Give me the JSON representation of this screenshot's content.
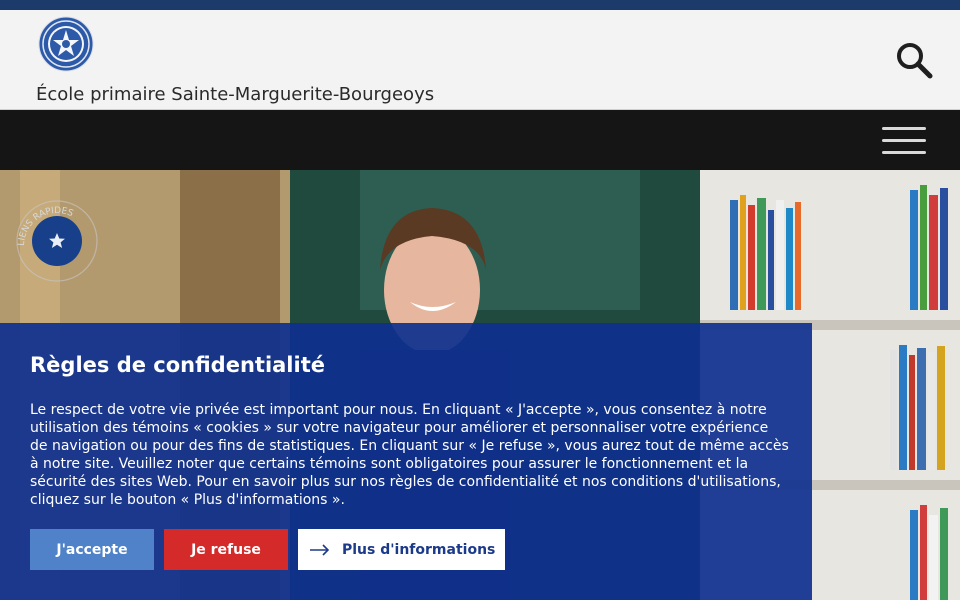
{
  "header": {
    "school_name": "École primaire Sainte-Marguerite-Bourgeoys",
    "logo_icon": "school-crest-icon",
    "search_icon": "search-icon"
  },
  "nav": {
    "menu_icon": "hamburger-menu-icon"
  },
  "hero": {
    "quick_links_label": "LIENS RAPIDES",
    "quick_links_icon": "star-icon"
  },
  "privacy": {
    "title": "Règles de confidentialité",
    "body": "Le respect de votre vie privée est important pour nous. En cliquant « J'accepte », vous consentez à notre utilisation des témoins « cookies » sur votre navigateur pour améliorer et personnaliser votre expérience de navigation ou pour des fins de statistiques. En cliquant sur « Je refuse », vous aurez tout de même accès à notre site. Veuillez noter que certains témoins sont obligatoires pour assurer le fonctionnement et la sécurité des sites Web. Pour en savoir plus sur nos règles de confidentialité et nos conditions d'utilisations, cliquez sur le bouton « Plus d'informations ».",
    "accept_label": "J'accepte",
    "refuse_label": "Je refuse",
    "more_label": "Plus d'informations",
    "more_icon": "arrow-right-icon"
  },
  "colors": {
    "top_strip": "#1c3a6a",
    "nav_bar": "#151515",
    "modal_bg": "#0e308e",
    "accept": "#4f82c9",
    "refuse": "#d42a2a",
    "more_text": "#1b3a8a"
  }
}
